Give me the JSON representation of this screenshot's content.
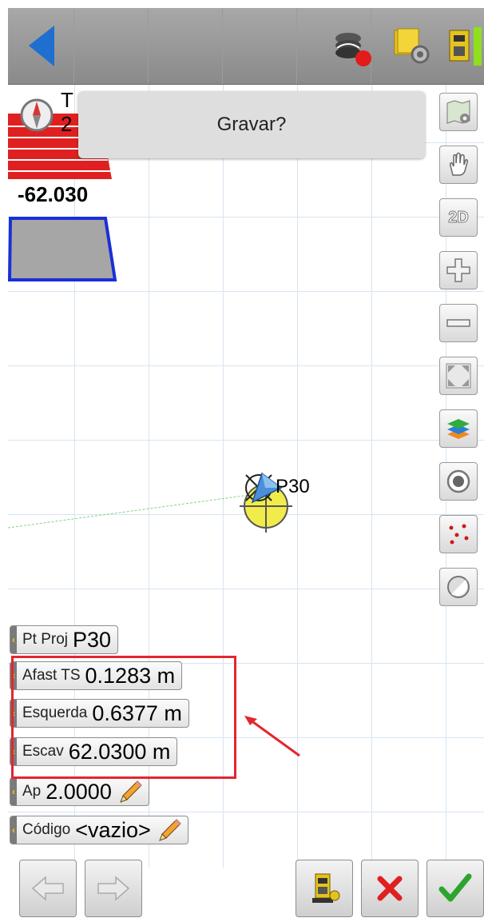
{
  "topbar": {
    "back_icon": "back-arrow-icon",
    "icons": [
      "survey-layers-record-icon",
      "job-settings-icon",
      "instrument-status-icon"
    ]
  },
  "dialog": {
    "text": "Gravar?"
  },
  "overlay": {
    "compass_icon": "compass-icon",
    "truncated_text_1": "T",
    "truncated_text_2": "2",
    "depth_value": "-62.030"
  },
  "map": {
    "point_label": "P30"
  },
  "right_toolbar": {
    "items": [
      {
        "name": "map-settings-icon"
      },
      {
        "name": "pan-hand-icon"
      },
      {
        "name": "view-2d-icon",
        "label": "2D"
      },
      {
        "name": "zoom-in-icon"
      },
      {
        "name": "zoom-out-icon"
      },
      {
        "name": "zoom-extents-icon"
      },
      {
        "name": "layers-icon"
      },
      {
        "name": "target-icon"
      },
      {
        "name": "points-icon"
      },
      {
        "name": "toggle-icon"
      }
    ]
  },
  "fields": [
    {
      "label": "Pt Proj",
      "value": "P30"
    },
    {
      "label": "Afast TS",
      "value": "0.1283 m"
    },
    {
      "label": "Esquerda",
      "value": "0.6377 m"
    },
    {
      "label": "Escav",
      "value": "62.0300 m"
    },
    {
      "label": "Ap",
      "value": "2.0000"
    },
    {
      "label": "Código",
      "value": "<vazio>"
    }
  ],
  "bottom_bar": {
    "buttons": [
      "prev-arrow-icon",
      "next-arrow-icon",
      "instrument-icon",
      "cancel-icon",
      "accept-icon"
    ]
  },
  "colors": {
    "accent_blue": "#1e6fd0",
    "cut_red": "#e02020",
    "section_blue": "#1a2fd6",
    "highlight_red": "#e3262f",
    "target_yellow": "#f1ec4a",
    "accept_green": "#2ca52c"
  }
}
